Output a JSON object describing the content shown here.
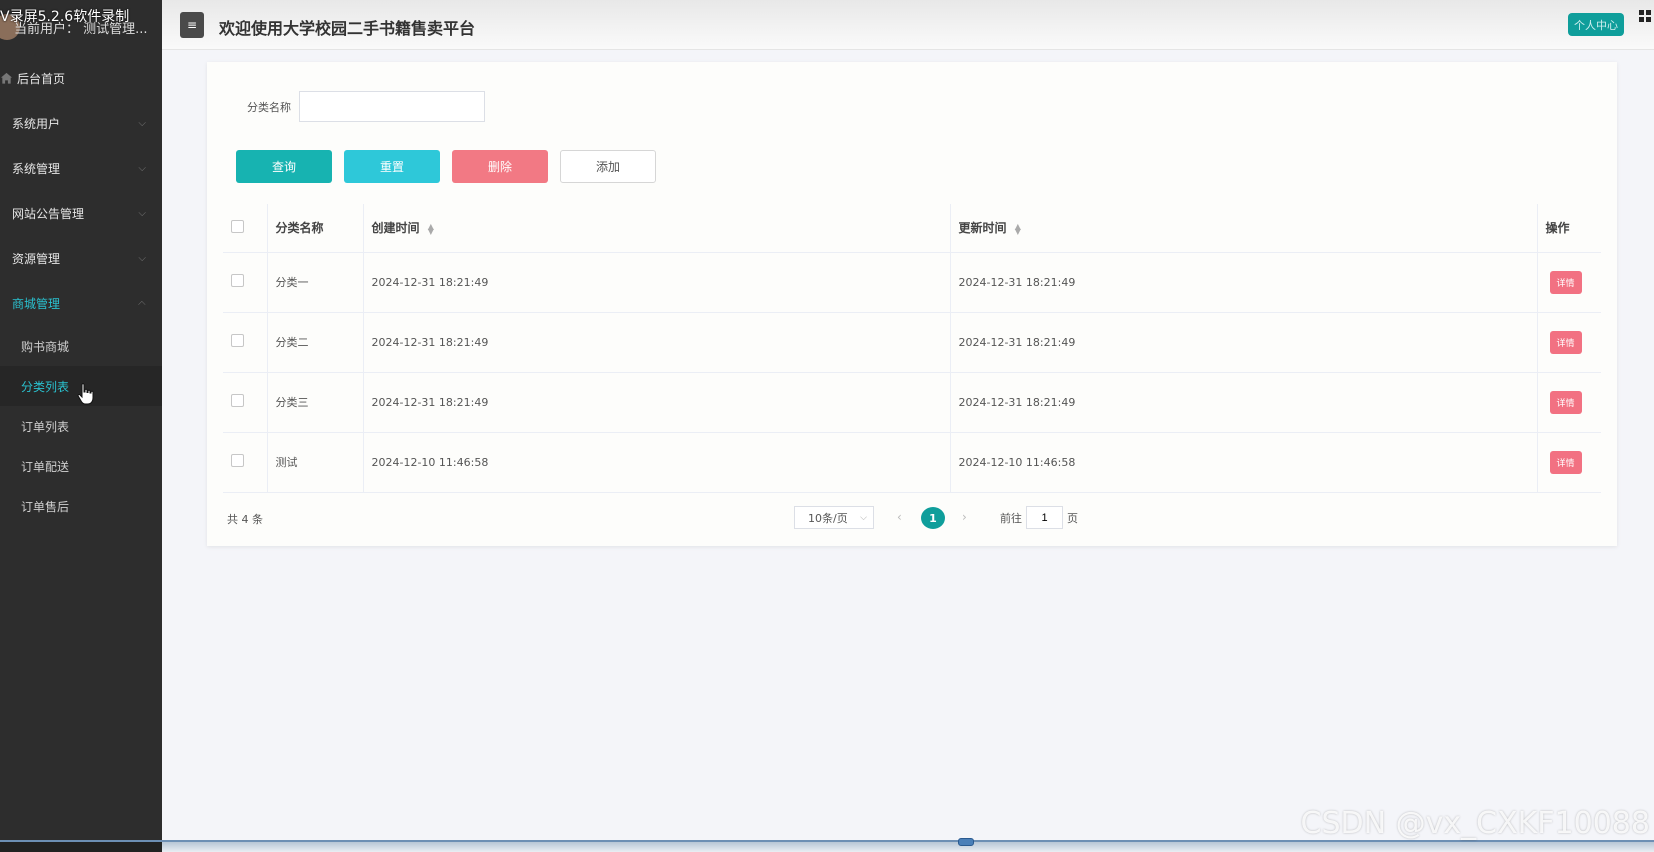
{
  "recorder": {
    "overlay_text": "V录屏5.2.6软件录制"
  },
  "sidebar": {
    "user_label": "当前用户：  测试管理...",
    "home_label": "后台首页",
    "menus": [
      {
        "label": "系统用户"
      },
      {
        "label": "系统管理"
      },
      {
        "label": "网站公告管理"
      },
      {
        "label": "资源管理"
      },
      {
        "label": "商城管理"
      }
    ],
    "sub_items": [
      {
        "label": "购书商城"
      },
      {
        "label": "分类列表"
      },
      {
        "label": "订单列表"
      },
      {
        "label": "订单配送"
      },
      {
        "label": "订单售后"
      }
    ]
  },
  "header": {
    "toggle_glyph": "≡",
    "title": "欢迎使用大学校园二手书籍售卖平台",
    "profile_label": "个人中心"
  },
  "search": {
    "label": "分类名称",
    "value": ""
  },
  "buttons": {
    "query": "查询",
    "reset": "重置",
    "delete": "删除",
    "add": "添加"
  },
  "table": {
    "headers": {
      "name": "分类名称",
      "created": "创建时间",
      "updated": "更新时间",
      "op": "操作"
    },
    "rows": [
      {
        "name": "分类一",
        "created": "2024-12-31 18:21:49",
        "updated": "2024-12-31 18:21:49",
        "action": "详情"
      },
      {
        "name": "分类二",
        "created": "2024-12-31 18:21:49",
        "updated": "2024-12-31 18:21:49",
        "action": "详情"
      },
      {
        "name": "分类三",
        "created": "2024-12-31 18:21:49",
        "updated": "2024-12-31 18:21:49",
        "action": "详情"
      },
      {
        "name": "测试",
        "created": "2024-12-10 11:46:58",
        "updated": "2024-12-10 11:46:58",
        "action": "详情"
      }
    ]
  },
  "pagination": {
    "total": "共 4 条",
    "page_size": "10条/页",
    "current_page": "1",
    "goto_prefix": "前往",
    "goto_value": "1",
    "goto_suffix": "页"
  },
  "watermark": "CSDN @vx_CXKF10088",
  "colors": {
    "sidebar_bg": "#2d2d2d",
    "accent": "#0f9e9b",
    "active_menu": "#2ac1cf",
    "danger": "#f27984"
  }
}
